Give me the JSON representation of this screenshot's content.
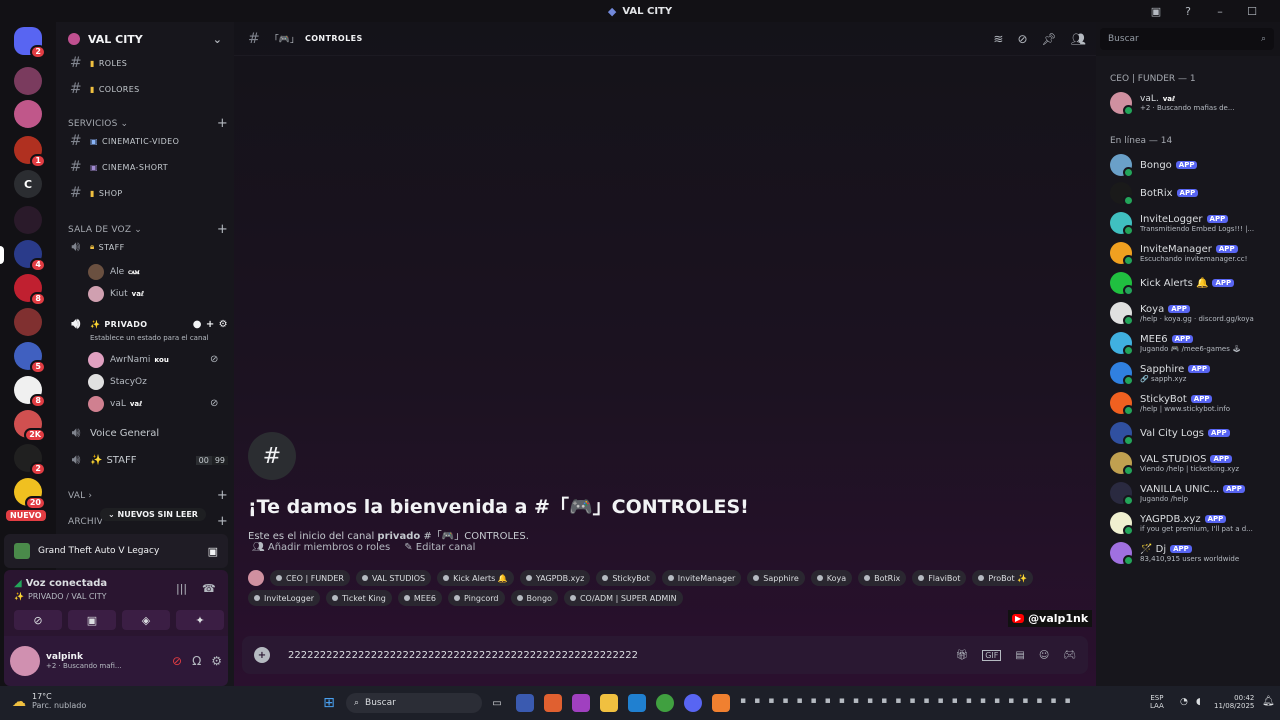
{
  "window": {
    "title": "VAL CITY"
  },
  "guilds": [
    {
      "letter": "",
      "badge": "2",
      "color": "#5865f2"
    },
    {
      "letter": "",
      "badge": "",
      "color": "#7a3b5e"
    },
    {
      "letter": "",
      "badge": "",
      "color": "#c0578a"
    },
    {
      "letter": "",
      "badge": "1",
      "color": "#b03020"
    },
    {
      "letter": "C",
      "badge": "",
      "color": "#2b2d31"
    },
    {
      "letter": "",
      "badge": "",
      "color": "#2a1a2a"
    },
    {
      "letter": "",
      "badge": "4",
      "color": "#2a3b8a"
    },
    {
      "letter": "",
      "badge": "8",
      "color": "#c02030"
    },
    {
      "letter": "",
      "badge": "",
      "color": "#803030"
    },
    {
      "letter": "",
      "badge": "5",
      "color": "#4060c0"
    },
    {
      "letter": "",
      "badge": "8",
      "color": "#f0f0f0"
    },
    {
      "letter": "",
      "badge": "2K",
      "color": "#d05050"
    },
    {
      "letter": "",
      "badge": "2",
      "color": "#202020"
    },
    {
      "letter": "",
      "badge": "20",
      "color": "#f0c020"
    }
  ],
  "sidebar": {
    "server_name": "VAL CITY",
    "channels_top": [
      {
        "name": "ROLES"
      },
      {
        "name": "COLORES"
      }
    ],
    "cat_servicios": "SERVICIOS",
    "channels_serv": [
      {
        "name": "CINEMATIC-VIDEO"
      },
      {
        "name": "CINEMA-SHORT"
      },
      {
        "name": "SHOP"
      }
    ],
    "cat_voz": "SALA DE VOZ",
    "staff": "STAFF",
    "staff_users": [
      {
        "name": "Ale",
        "tag": "ꮯꭺꮇ"
      },
      {
        "name": "Kiut",
        "tag": "vaℓ"
      }
    ],
    "privado": "PRIVADO",
    "estado": "Establece un estado para el canal",
    "priv_users": [
      {
        "name": "AwrNami",
        "tag": "ĸou"
      },
      {
        "name": "StacyOz",
        "tag": ""
      },
      {
        "name": "vaL",
        "tag": "vaℓ"
      }
    ],
    "voice_general": "Voice General",
    "staff2": "STAFF",
    "staff2_counts": [
      "00",
      "99"
    ],
    "cat_val": "VAL",
    "cat_archi": "ARCHIV",
    "nuevos": "NUEVOS SIN LEER",
    "nuevo": "NUEVO",
    "game": "Grand Theft Auto V Legacy",
    "voice_status": "Voz conectada",
    "voice_channel": "PRIVADO / VAL CITY",
    "user": {
      "name": "valpink",
      "status": "+2 · Buscando mafi..."
    }
  },
  "main": {
    "channel": "CONTROLES",
    "welcome_title": "¡Te damos la bienvenida a #「🎮」CONTROLES!",
    "welcome_sub_a": "Este es el inicio del canal ",
    "welcome_sub_b": "privado",
    "welcome_sub_c": " #「🎮」CONTROLES.",
    "add_members": "Añadir miembros o roles",
    "edit_channel": "Editar canal",
    "roles": [
      "CEO | FUNDER",
      "VAL STUDIOS",
      "Kick Alerts 🔔",
      "YAGPDB.xyz",
      "StickyBot",
      "InviteManager",
      "Sapphire",
      "Koya",
      "BotRix",
      "FlaviBot",
      "ProBot ✨",
      "InviteLogger",
      "Ticket King",
      "MEE6",
      "Pingcord",
      "Bongo",
      "CO/ADM | SUPER ADMIN"
    ],
    "input_text": "2222222222222222222222222222222222222222222222222222222",
    "yt_handle": "@valp1nk"
  },
  "search": {
    "placeholder": "Buscar"
  },
  "members": {
    "group1": "CEO | FUNDER — 1",
    "ceo": {
      "name": "vaL.",
      "tag": "vaℓ",
      "status": "+2 · Buscando mafias de..."
    },
    "group2": "En línea — 14",
    "list": [
      {
        "name": "Bongo",
        "status": "",
        "color": "#6aa0c8"
      },
      {
        "name": "BotRix",
        "status": "",
        "color": "#1a1a1a"
      },
      {
        "name": "InviteLogger",
        "status": "Transmitiendo Embed Logs!!! |...",
        "color": "#40c0c0"
      },
      {
        "name": "InviteManager",
        "status": "Escuchando invitemanager.cc!",
        "color": "#f0a020"
      },
      {
        "name": "Kick Alerts 🔔",
        "status": "",
        "color": "#20c040"
      },
      {
        "name": "Koya",
        "status": "/help · koya.gg · discord.gg/koya",
        "color": "#e0e0e0"
      },
      {
        "name": "MEE6",
        "status": "Jugando 🎮 /mee6-games 🕹",
        "color": "#40b0e0"
      },
      {
        "name": "Sapphire",
        "status": "🔗 sapph.xyz",
        "color": "#3080e0"
      },
      {
        "name": "StickyBot",
        "status": "/help | www.stickybot.info",
        "color": "#f06020"
      },
      {
        "name": "Val City Logs",
        "status": "",
        "color": "#3050a0"
      },
      {
        "name": "VAL STUDIOS",
        "status": "Viendo /help | ticketking.xyz",
        "color": "#c0a050"
      },
      {
        "name": "VANILLA UNIC...",
        "status": "Jugando /help",
        "color": "#2a2a40"
      },
      {
        "name": "YAGPDB.xyz",
        "status": "if you get premium, I'll pat a d...",
        "color": "#f0f0d0"
      },
      {
        "name": "🪄 Dj",
        "status": "83,410,915 users worldwide",
        "color": "#a070e0"
      }
    ],
    "app_label": "APP"
  },
  "taskbar": {
    "temp": "17°C",
    "weather": "Parc. nublado",
    "search": "Buscar",
    "lang1": "ESP",
    "lang2": "LAA",
    "time": "00:42",
    "date": "11/08/2025"
  }
}
